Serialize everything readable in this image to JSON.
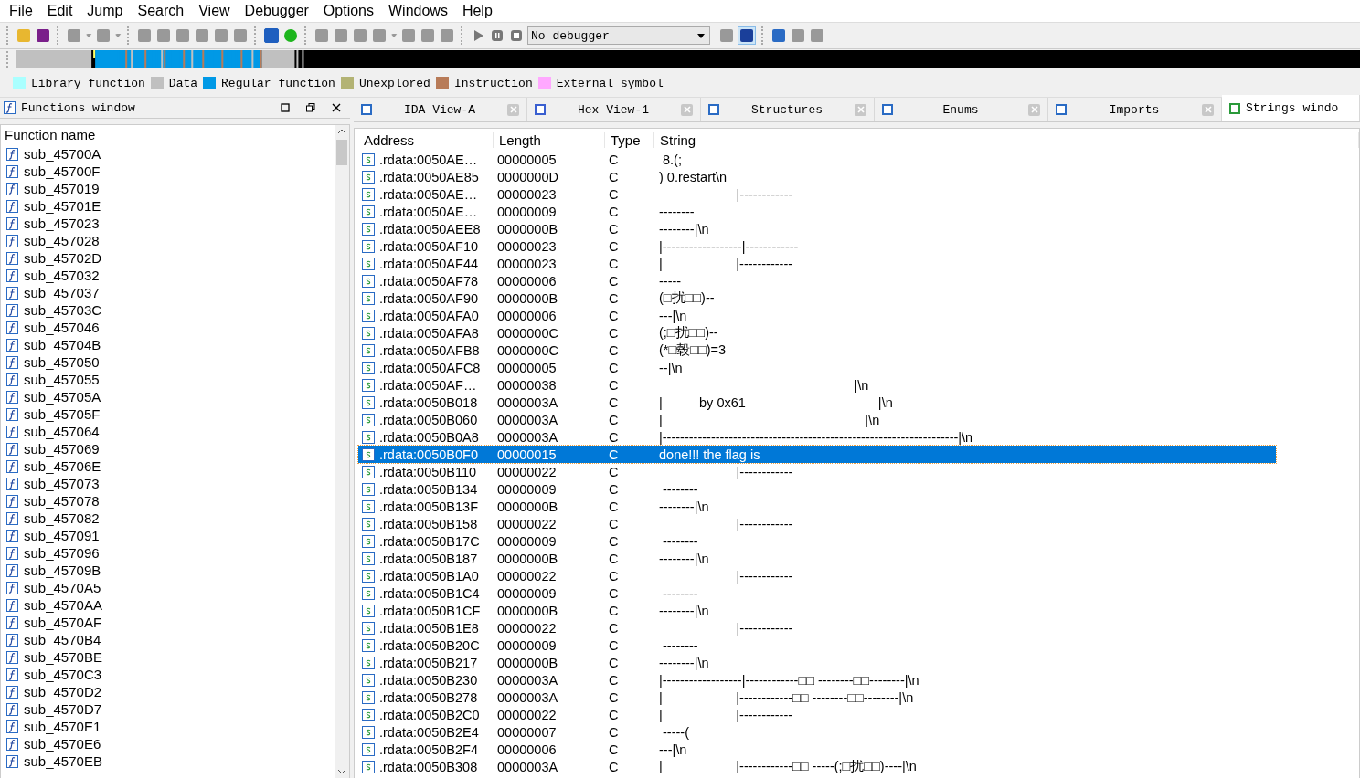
{
  "menu": [
    "File",
    "Edit",
    "Jump",
    "Search",
    "View",
    "Debugger",
    "Options",
    "Windows",
    "Help"
  ],
  "toolbar": {
    "debugger_select": "No debugger"
  },
  "legend": [
    {
      "label": "Library function",
      "color": "#aaffff"
    },
    {
      "label": "Data",
      "color": "#c0c0c0"
    },
    {
      "label": "Regular function",
      "color": "#0099e6"
    },
    {
      "label": "Unexplored",
      "color": "#b3b374"
    },
    {
      "label": "Instruction",
      "color": "#b87b58"
    },
    {
      "label": "External symbol",
      "color": "#ffa8ff"
    }
  ],
  "functions_window": {
    "title": "Functions window",
    "column": "Function name",
    "items": [
      "sub_45700A",
      "sub_45700F",
      "sub_457019",
      "sub_45701E",
      "sub_457023",
      "sub_457028",
      "sub_45702D",
      "sub_457032",
      "sub_457037",
      "sub_45703C",
      "sub_457046",
      "sub_45704B",
      "sub_457050",
      "sub_457055",
      "sub_45705A",
      "sub_45705F",
      "sub_457064",
      "sub_457069",
      "sub_45706E",
      "sub_457073",
      "sub_457078",
      "sub_457082",
      "sub_457091",
      "sub_457096",
      "sub_45709B",
      "sub_4570A5",
      "sub_4570AA",
      "sub_4570AF",
      "sub_4570B4",
      "sub_4570BE",
      "sub_4570C3",
      "sub_4570D2",
      "sub_4570D7",
      "sub_4570E1",
      "sub_4570E6",
      "sub_4570EB"
    ]
  },
  "tabs": [
    {
      "label": "IDA View-A",
      "kind": "ida",
      "selected": false
    },
    {
      "label": "Hex View-1",
      "kind": "hex",
      "selected": false
    },
    {
      "label": "Structures",
      "kind": "struct",
      "selected": false
    },
    {
      "label": "Enums",
      "kind": "enum",
      "selected": false
    },
    {
      "label": "Imports",
      "kind": "imports",
      "selected": false
    },
    {
      "label": "Strings windo",
      "kind": "strings",
      "selected": true
    }
  ],
  "strings_table": {
    "columns": [
      "Address",
      "Length",
      "Type",
      "String"
    ],
    "rows": [
      {
        "address": ".rdata:0050AE…",
        "length": "00000005",
        "type": "C",
        "string": " 8.(;",
        "selected": false
      },
      {
        "address": ".rdata:0050AE85",
        "length": "0000000D",
        "type": "C",
        "string": ") 0.restart\\n",
        "selected": false
      },
      {
        "address": ".rdata:0050AE…",
        "length": "00000023",
        "type": "C",
        "string": "                     |------------",
        "selected": false
      },
      {
        "address": ".rdata:0050AE…",
        "length": "00000009",
        "type": "C",
        "string": "--------",
        "selected": false
      },
      {
        "address": ".rdata:0050AEE8",
        "length": "0000000B",
        "type": "C",
        "string": "--------|\\n",
        "selected": false
      },
      {
        "address": ".rdata:0050AF10",
        "length": "00000023",
        "type": "C",
        "string": "|------------------|------------",
        "selected": false
      },
      {
        "address": ".rdata:0050AF44",
        "length": "00000023",
        "type": "C",
        "string": "|                    |------------",
        "selected": false
      },
      {
        "address": ".rdata:0050AF78",
        "length": "00000006",
        "type": "C",
        "string": "-----",
        "selected": false
      },
      {
        "address": ".rdata:0050AF90",
        "length": "0000000B",
        "type": "C",
        "string": "(□扰□□)--",
        "selected": false
      },
      {
        "address": ".rdata:0050AFA0",
        "length": "00000006",
        "type": "C",
        "string": "---|\\n",
        "selected": false
      },
      {
        "address": ".rdata:0050AFA8",
        "length": "0000000C",
        "type": "C",
        "string": "(;□扰□□)--",
        "selected": false
      },
      {
        "address": ".rdata:0050AFB8",
        "length": "0000000C",
        "type": "C",
        "string": "(*□毂□□)=3",
        "selected": false
      },
      {
        "address": ".rdata:0050AFC8",
        "length": "00000005",
        "type": "C",
        "string": "--|\\n",
        "selected": false
      },
      {
        "address": ".rdata:0050AF…",
        "length": "00000038",
        "type": "C",
        "string": "                                                     |\\n",
        "selected": false
      },
      {
        "address": ".rdata:0050B018",
        "length": "0000003A",
        "type": "C",
        "string": "|          by 0x61                                    |\\n",
        "selected": false
      },
      {
        "address": ".rdata:0050B060",
        "length": "0000003A",
        "type": "C",
        "string": "|                                                       |\\n",
        "selected": false
      },
      {
        "address": ".rdata:0050B0A8",
        "length": "0000003A",
        "type": "C",
        "string": "|-------------------------------------------------------------------|\\n",
        "selected": false
      },
      {
        "address": ".rdata:0050B0F0",
        "length": "00000015",
        "type": "C",
        "string": "done!!! the flag is",
        "selected": true
      },
      {
        "address": ".rdata:0050B110",
        "length": "00000022",
        "type": "C",
        "string": "                     |------------",
        "selected": false
      },
      {
        "address": ".rdata:0050B134",
        "length": "00000009",
        "type": "C",
        "string": " --------",
        "selected": false
      },
      {
        "address": ".rdata:0050B13F",
        "length": "0000000B",
        "type": "C",
        "string": "--------|\\n",
        "selected": false
      },
      {
        "address": ".rdata:0050B158",
        "length": "00000022",
        "type": "C",
        "string": "                     |------------",
        "selected": false
      },
      {
        "address": ".rdata:0050B17C",
        "length": "00000009",
        "type": "C",
        "string": " --------",
        "selected": false
      },
      {
        "address": ".rdata:0050B187",
        "length": "0000000B",
        "type": "C",
        "string": "--------|\\n",
        "selected": false
      },
      {
        "address": ".rdata:0050B1A0",
        "length": "00000022",
        "type": "C",
        "string": "                     |------------",
        "selected": false
      },
      {
        "address": ".rdata:0050B1C4",
        "length": "00000009",
        "type": "C",
        "string": " --------",
        "selected": false
      },
      {
        "address": ".rdata:0050B1CF",
        "length": "0000000B",
        "type": "C",
        "string": "--------|\\n",
        "selected": false
      },
      {
        "address": ".rdata:0050B1E8",
        "length": "00000022",
        "type": "C",
        "string": "                     |------------",
        "selected": false
      },
      {
        "address": ".rdata:0050B20C",
        "length": "00000009",
        "type": "C",
        "string": " --------",
        "selected": false
      },
      {
        "address": ".rdata:0050B217",
        "length": "0000000B",
        "type": "C",
        "string": "--------|\\n",
        "selected": false
      },
      {
        "address": ".rdata:0050B230",
        "length": "0000003A",
        "type": "C",
        "string": "|------------------|------------□□ --------□□--------|\\n",
        "selected": false
      },
      {
        "address": ".rdata:0050B278",
        "length": "0000003A",
        "type": "C",
        "string": "|                    |------------□□ --------□□--------|\\n",
        "selected": false
      },
      {
        "address": ".rdata:0050B2C0",
        "length": "00000022",
        "type": "C",
        "string": "|                    |------------",
        "selected": false
      },
      {
        "address": ".rdata:0050B2E4",
        "length": "00000007",
        "type": "C",
        "string": " -----(",
        "selected": false
      },
      {
        "address": ".rdata:0050B2F4",
        "length": "00000006",
        "type": "C",
        "string": "---|\\n",
        "selected": false
      },
      {
        "address": ".rdata:0050B308",
        "length": "0000003A",
        "type": "C",
        "string": "|                    |------------□□ -----(;□扰□□)----|\\n",
        "selected": false
      }
    ]
  }
}
